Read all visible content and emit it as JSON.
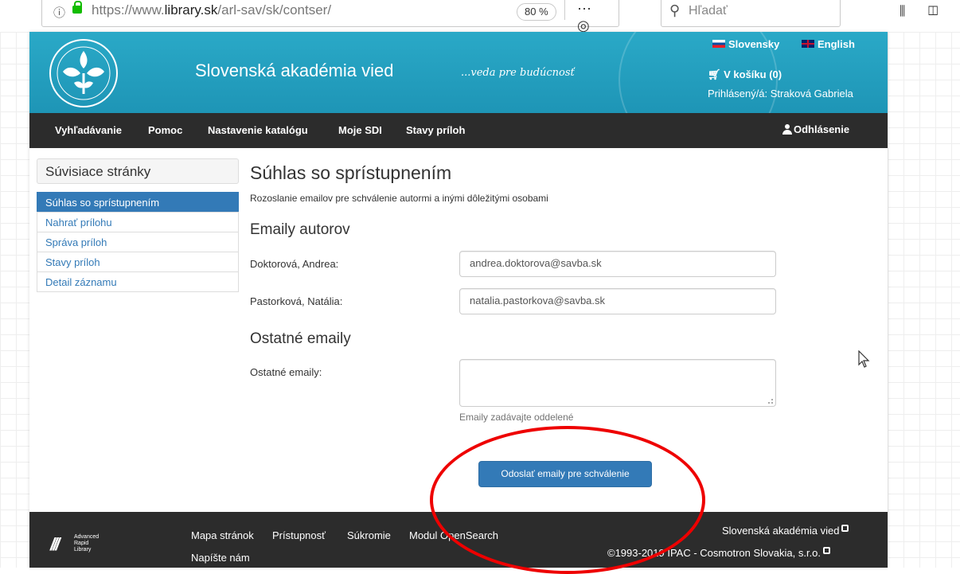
{
  "browser": {
    "url_prefix": "https://www.",
    "url_host": "library.sk",
    "url_path": "/arl-sav/sk/contser/",
    "zoom": "80 %",
    "search_placeholder": "Hľadať"
  },
  "header": {
    "site_title": "Slovenská akadémia vied",
    "motto": "...veda pre budúcnosť",
    "lang_sk": "Slovensky",
    "lang_en": "English",
    "cart": "V košíku (0)",
    "login_info": "Prihlásený/á: Straková Gabriela"
  },
  "nav": {
    "items": [
      "Vyhľadávanie",
      "Pomoc",
      "Nastavenie katalógu",
      "Moje SDI",
      "Stavy príloh"
    ],
    "logout": "Odhlásenie"
  },
  "sidebar": {
    "heading": "Súvisiace stránky",
    "items": [
      {
        "label": "Súhlas so sprístupnením",
        "active": true
      },
      {
        "label": "Nahrať prílohu",
        "active": false
      },
      {
        "label": "Správa príloh",
        "active": false
      },
      {
        "label": "Stavy príloh",
        "active": false
      },
      {
        "label": "Detail záznamu",
        "active": false
      }
    ]
  },
  "main": {
    "title": "Súhlas so sprístupnením",
    "subtitle": "Rozoslanie emailov pre schválenie autormi a inými dôležitými osobami",
    "authors_heading": "Emaily autorov",
    "authors": [
      {
        "name": "Doktorová, Andrea:",
        "email": "andrea.doktorova@savba.sk"
      },
      {
        "name": "Pastorková, Natália:",
        "email": "natalia.pastorkova@savba.sk"
      }
    ],
    "other_heading": "Ostatné emaily",
    "other_label": "Ostatné emaily:",
    "other_value": "",
    "help_text": "Emaily zadávajte oddelené",
    "submit_label": "Odoslať emaily pre schválenie"
  },
  "footer": {
    "logo_text": [
      "Advanced",
      "Rapid",
      "Library"
    ],
    "links": [
      "Mapa stránok",
      "Prístupnosť",
      "Súkromie",
      "Modul OpenSearch",
      "Napíšte nám"
    ],
    "org": "Slovenská akadémia vied",
    "copyright": "©1993-2019 IPAC - Cosmotron Slovakia, s.r.o."
  },
  "colors": {
    "banner": "#1e95b6",
    "navbar": "#2c2c2c",
    "primary": "#337ab7",
    "annotation": "#e00000"
  }
}
